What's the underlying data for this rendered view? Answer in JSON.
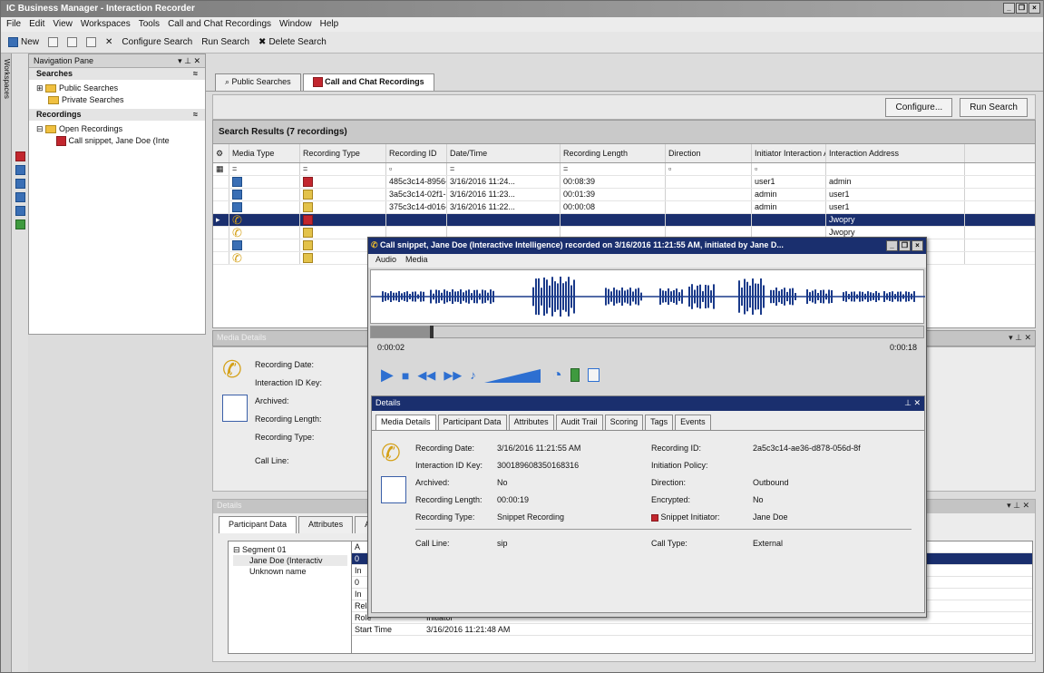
{
  "window": {
    "title": "IC Business Manager - Interaction Recorder"
  },
  "menu": [
    "File",
    "Edit",
    "View",
    "Workspaces",
    "Tools",
    "Call and Chat Recordings",
    "Window",
    "Help"
  ],
  "toolbar": {
    "new": "New",
    "configure_search": "Configure Search",
    "run_search": "Run Search",
    "delete_search": "Delete Search"
  },
  "side_tab": "Workspaces",
  "nav": {
    "title": "Navigation Pane",
    "searches_header": "Searches",
    "public_searches": "Public Searches",
    "private_searches": "Private Searches",
    "recordings_header": "Recordings",
    "open_recordings": "Open Recordings",
    "call_snippet": "Call snippet, Jane Doe (Inte"
  },
  "tabs": {
    "public": "Public Searches",
    "recordings": "Call and Chat Recordings"
  },
  "actions": {
    "configure": "Configure...",
    "run_search": "Run Search"
  },
  "results": {
    "header": "Search Results (7 recordings)",
    "columns": [
      "Media Type",
      "Recording Type",
      "Recording ID",
      "Date/Time",
      "Recording Length",
      "Direction",
      "Initiator Interaction Address",
      "Interaction Address"
    ],
    "filter_row": [
      "",
      "",
      "",
      "",
      "",
      "",
      "",
      ""
    ],
    "rows": [
      {
        "id": "485c3c14-8956-...",
        "date": "3/16/2016 11:24...",
        "len": "00:08:39",
        "dir": "",
        "init": "user1",
        "addr": "admin"
      },
      {
        "id": "3a5c3c14-02f1-...",
        "date": "3/16/2016 11:23...",
        "len": "00:01:39",
        "dir": "",
        "init": "admin",
        "addr": "user1"
      },
      {
        "id": "375c3c14-d016-...",
        "date": "3/16/2016 11:22...",
        "len": "00:00:08",
        "dir": "",
        "init": "admin",
        "addr": "user1"
      },
      {
        "id": "",
        "date": "",
        "len": "",
        "dir": "",
        "init": "",
        "addr": "Jwopry"
      },
      {
        "id": "",
        "date": "",
        "len": "",
        "dir": "",
        "init": "",
        "addr": "Jwopry"
      },
      {
        "id": "",
        "date": "",
        "len": "",
        "dir": "",
        "init": "",
        "addr": ""
      },
      {
        "id": "",
        "date": "",
        "len": "",
        "dir": "",
        "init": "",
        "addr": "Jwopry"
      }
    ]
  },
  "media_details_bar": "Media Details",
  "media_details": {
    "recording_date": "Recording Date:",
    "interaction_id_key": "Interaction ID Key:",
    "archived": "Archived:",
    "recording_length": "Recording Length:",
    "recording_type": "Recording Type:",
    "call_line": "Call Line:"
  },
  "lower_details": {
    "title": "Details",
    "tabs": [
      "Participant Data",
      "Attributes",
      "Aud"
    ],
    "tree": [
      "Segment 01",
      "Jane Doe (Interactiv",
      "Unknown name"
    ],
    "rows": [
      {
        "k": "A",
        "v": ""
      },
      {
        "k": "0",
        "v": ""
      },
      {
        "k": "In",
        "v": ""
      },
      {
        "k": "0",
        "v": ""
      },
      {
        "k": "In",
        "v": ""
      },
      {
        "k": "Related Records...",
        "v": "No"
      },
      {
        "k": "Role",
        "v": "Initiator"
      },
      {
        "k": "Start Time",
        "v": "3/16/2016 11:21:48 AM"
      }
    ]
  },
  "player": {
    "title": "Call snippet, Jane Doe (Interactive Intelligence) recorded on 3/16/2016 11:21:55 AM, initiated by Jane D...",
    "menu": [
      "Audio",
      "Media"
    ],
    "time_current": "0:00:02",
    "time_total": "0:00:18",
    "progress": 0.11
  },
  "details": {
    "title": "Details",
    "tabs": [
      "Media Details",
      "Participant Data",
      "Attributes",
      "Audit Trail",
      "Scoring",
      "Tags",
      "Events"
    ],
    "rows": [
      {
        "l1": "Recording Date:",
        "v1": "3/16/2016 11:21:55 AM",
        "l2": "Recording ID:",
        "v2": "2a5c3c14-ae36-d878-056d-8f"
      },
      {
        "l1": "Interaction ID Key:",
        "v1": "300189608350168316",
        "l2": "Initiation Policy:",
        "v2": ""
      },
      {
        "l1": "Archived:",
        "v1": "No",
        "l2": "Direction:",
        "v2": "Outbound"
      },
      {
        "l1": "Recording Length:",
        "v1": "00:00:19",
        "l2": "Encrypted:",
        "v2": "No"
      },
      {
        "l1": "Recording Type:",
        "v1": "Snippet Recording",
        "l2": "Snippet Initiator:",
        "v2": "Jane Doe"
      }
    ],
    "call_row": {
      "l1": "Call Line:",
      "v1": "sip",
      "l2": "Call Type:",
      "v2": "External"
    }
  },
  "colors": {
    "selection": "#1a2f6e",
    "waveform": "#1a3a8a",
    "title_gradient": "#7a7a7a"
  }
}
